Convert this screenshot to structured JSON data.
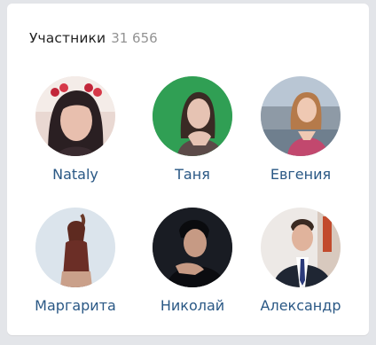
{
  "members_block": {
    "title": "Участники",
    "count": "31 656",
    "members": [
      {
        "name": "Nataly"
      },
      {
        "name": "Таня"
      },
      {
        "name": "Евгения"
      },
      {
        "name": "Маргарита"
      },
      {
        "name": "Николай"
      },
      {
        "name": "Александр"
      }
    ]
  },
  "colors": {
    "link": "#2a5885",
    "count": "#939393",
    "title": "#222222",
    "background": "#e3e5e9",
    "card": "#ffffff"
  }
}
